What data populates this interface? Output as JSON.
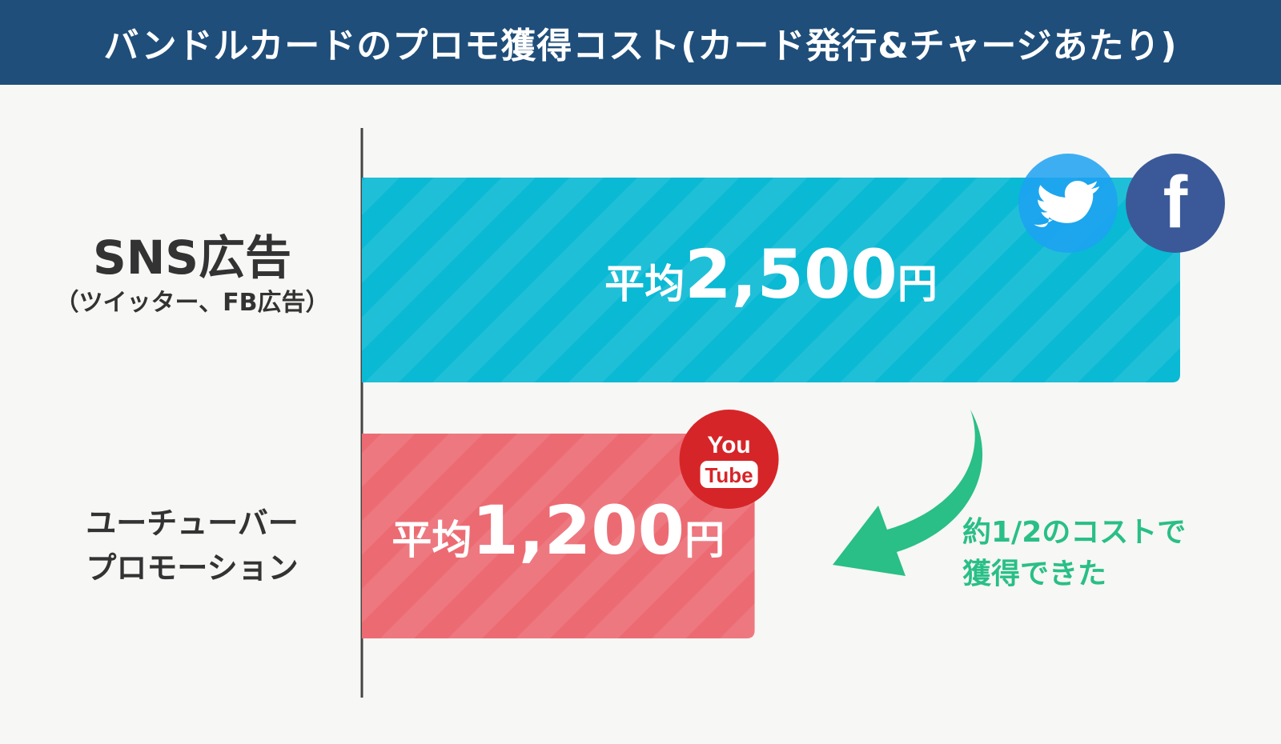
{
  "header": {
    "title": "バンドルカードのプロモ獲得コスト(カード発行&チャージあたり)"
  },
  "chart_data": {
    "type": "bar",
    "orientation": "horizontal",
    "title": "バンドルカードのプロモ獲得コスト(カード発行&チャージあたり)",
    "categories": [
      {
        "main": "SNS広告",
        "sub": "（ツイッター、FB広告）",
        "lines": [
          "SNS広告",
          "（ツイッター、FB広告）"
        ]
      },
      {
        "main": "ユーチューバー",
        "sub": "プロモーション",
        "lines": [
          "ユーチューバー",
          "プロモーション"
        ]
      }
    ],
    "values": [
      2500,
      1200
    ],
    "value_labels": [
      {
        "prefix": "平均",
        "number": "2,500",
        "unit": "円"
      },
      {
        "prefix": "平均",
        "number": "1,200",
        "unit": "円"
      }
    ],
    "bar_colors": [
      "#0ab9d4",
      "#ec6b73"
    ],
    "bar_icons": [
      [
        "twitter-icon",
        "facebook-icon"
      ],
      [
        "youtube-icon"
      ]
    ],
    "xlim": [
      0,
      2500
    ],
    "grid": false,
    "xlabel": "",
    "ylabel": ""
  },
  "annotation": {
    "lines": [
      "約1/2のコストで",
      "獲得できた"
    ],
    "color": "#29bf86"
  },
  "icons": {
    "youtube_top": "You",
    "youtube_bottom": "Tube"
  },
  "colors": {
    "header_bg": "#1f4e7a",
    "background": "#f7f7f5",
    "twitter": "#1da1f2",
    "facebook": "#3b5998",
    "youtube": "#d62528",
    "arrow": "#29bf86"
  }
}
